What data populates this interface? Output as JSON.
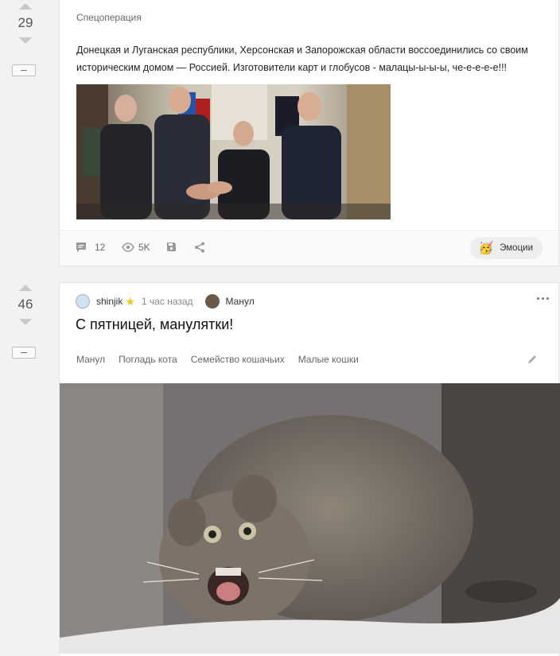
{
  "post1": {
    "score": "29",
    "tag": "Спецоперация",
    "text": "Донецкая и Луганская республики, Херсонская и Запорожская области воссоединились со своим историческим домом — Россией. Изготовители карт и глобусов - малацы-ы-ы-ы, че-е-е-е-е!!!",
    "comments": "12",
    "views": "5K",
    "emotions_label": "Эмоции"
  },
  "post2": {
    "score": "46",
    "author": "shinjik",
    "time": "1 час назад",
    "community": "Манул",
    "title": "С пятницей, манулятки!",
    "tags": [
      "Манул",
      "Погладь кота",
      "Семейство кошачьих",
      "Малые кошки"
    ]
  },
  "colors": {
    "star": "#f5c518",
    "accent": "#8ac858"
  },
  "icons": [
    "comment-icon",
    "eye-icon",
    "save-icon",
    "share-icon",
    "emoji-icon",
    "edit-icon",
    "star-icon",
    "more-icon"
  ]
}
